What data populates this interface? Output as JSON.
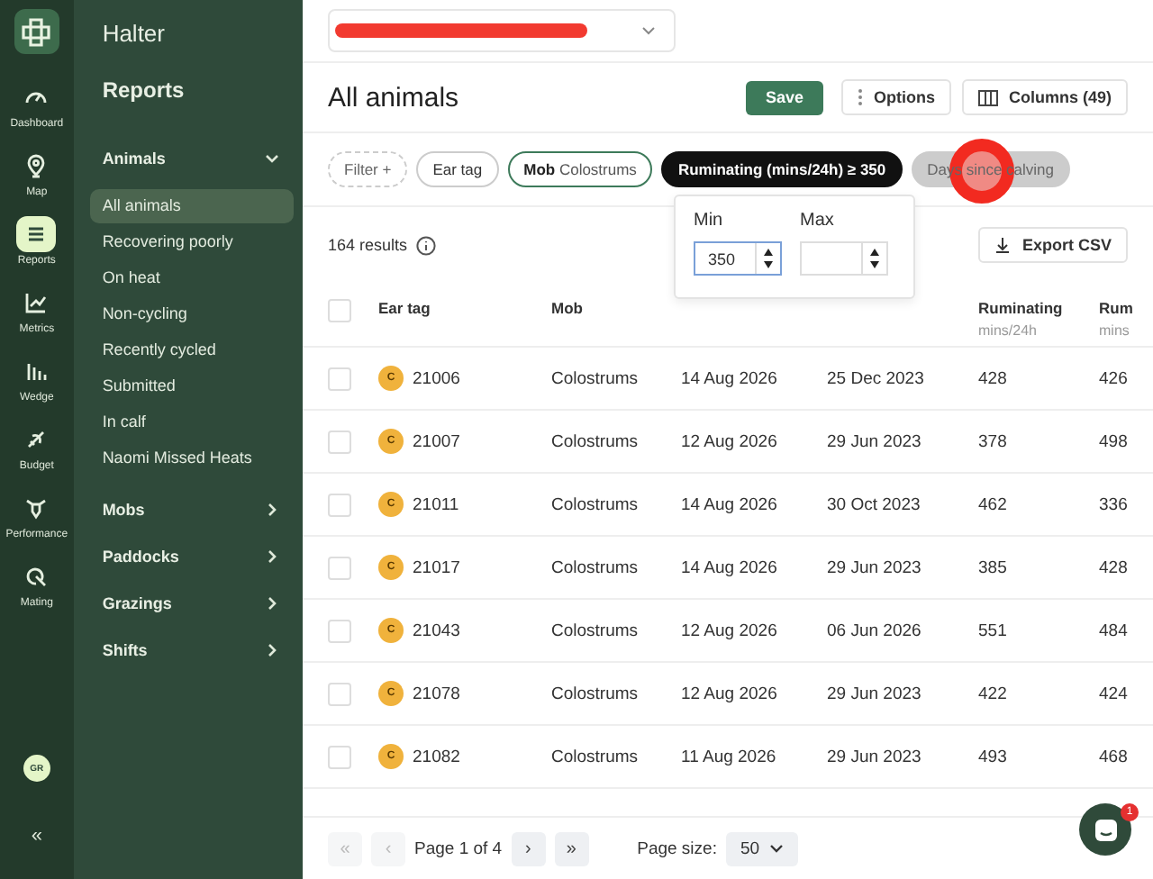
{
  "rail": {
    "items": [
      {
        "label": "Dashboard",
        "selected": false
      },
      {
        "label": "Map",
        "selected": false
      },
      {
        "label": "Reports",
        "selected": true
      },
      {
        "label": "Metrics",
        "selected": false
      },
      {
        "label": "Wedge",
        "selected": false
      },
      {
        "label": "Budget",
        "selected": false
      },
      {
        "label": "Performance",
        "selected": false
      },
      {
        "label": "Mating",
        "selected": false
      }
    ],
    "avatar": "GR",
    "collapse": "«"
  },
  "sidebar": {
    "brand": "Halter",
    "title": "Reports",
    "sections": [
      {
        "label": "Animals",
        "expanded": true,
        "items": [
          {
            "label": "All animals",
            "selected": true
          },
          {
            "label": "Recovering poorly",
            "selected": false
          },
          {
            "label": "On heat",
            "selected": false
          },
          {
            "label": "Non-cycling",
            "selected": false
          },
          {
            "label": "Recently cycled",
            "selected": false
          },
          {
            "label": "Submitted",
            "selected": false
          },
          {
            "label": "In calf",
            "selected": false
          },
          {
            "label": "Naomi Missed Heats",
            "selected": false
          }
        ]
      },
      {
        "label": "Mobs",
        "expanded": false
      },
      {
        "label": "Paddocks",
        "expanded": false
      },
      {
        "label": "Grazings",
        "expanded": false
      },
      {
        "label": "Shifts",
        "expanded": false
      }
    ]
  },
  "page": {
    "title": "All animals",
    "buttons": {
      "save": "Save",
      "options": "Options",
      "columns": "Columns (49)"
    },
    "filters": [
      {
        "kind": "add",
        "label": "Filter",
        "suffix": "+"
      },
      {
        "kind": "plain",
        "label": "Ear tag"
      },
      {
        "kind": "outlined",
        "label": "**Mob** Colostrums"
      },
      {
        "kind": "active",
        "label": "Ruminating (mins/24h) ≥ 350"
      },
      {
        "kind": "muted",
        "label": "Days since calving"
      }
    ],
    "popover": {
      "min_label": "Min",
      "min_value": "350",
      "max_label": "Max"
    },
    "results": "164 results",
    "export": "Export CSV"
  },
  "table": {
    "select_all_checked": false,
    "columns": [
      {
        "label": "Ear tag"
      },
      {
        "label": "Mob"
      },
      null,
      null,
      {
        "label": "Ruminating",
        "unit": "mins/24h"
      },
      {
        "label": "Rum",
        "unit": "mins"
      }
    ],
    "rows": [
      {
        "checked": false,
        "badge": "C",
        "cells": [
          "21006",
          "Colostrums",
          "14 Aug 2026",
          "25 Dec 2023",
          "428",
          "426"
        ]
      },
      {
        "checked": false,
        "badge": "C",
        "cells": [
          "21007",
          "Colostrums",
          "12 Aug 2026",
          "29 Jun 2023",
          "378",
          "498"
        ]
      },
      {
        "checked": false,
        "badge": "C",
        "cells": [
          "21011",
          "Colostrums",
          "14 Aug 2026",
          "30 Oct 2023",
          "462",
          "336"
        ]
      },
      {
        "checked": false,
        "badge": "C",
        "cells": [
          "21017",
          "Colostrums",
          "14 Aug 2026",
          "29 Jun 2023",
          "385",
          "428"
        ]
      },
      {
        "checked": false,
        "badge": "C",
        "cells": [
          "21043",
          "Colostrums",
          "12 Aug 2026",
          "06 Jun 2026",
          "551",
          "484"
        ]
      },
      {
        "checked": false,
        "badge": "C",
        "cells": [
          "21078",
          "Colostrums",
          "12 Aug 2026",
          "29 Jun 2023",
          "422",
          "424"
        ]
      },
      {
        "checked": false,
        "badge": "C",
        "cells": [
          "21082",
          "Colostrums",
          "11 Aug 2026",
          "29 Jun 2023",
          "493",
          "468"
        ]
      }
    ]
  },
  "pagination": {
    "first": "«",
    "prev": "‹",
    "page": "Page 1 of 4",
    "next": "›",
    "last": "»",
    "size_label": "Page size:",
    "size": "50"
  },
  "chat": {
    "badge": "1"
  }
}
